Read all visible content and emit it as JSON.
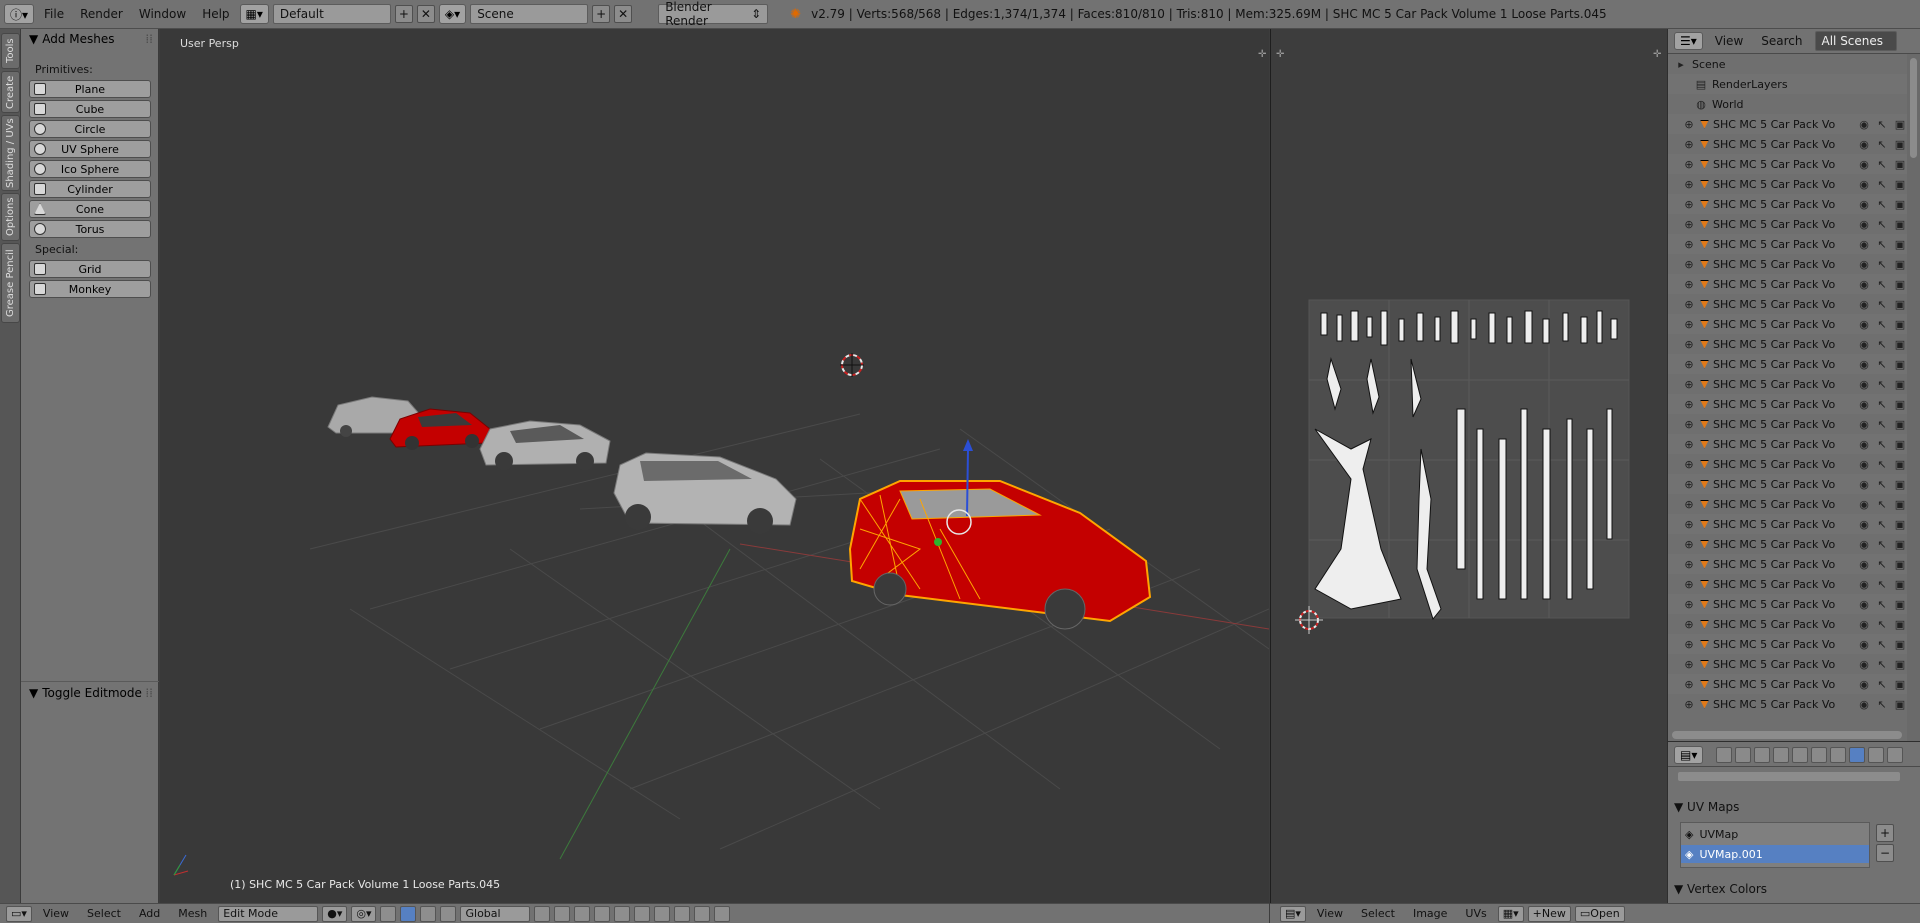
{
  "topbar": {
    "menus": [
      "File",
      "Render",
      "Window",
      "Help"
    ],
    "layout": "Default",
    "scene": "Scene",
    "engine": "Blender Render",
    "info": "v2.79 | Verts:568/568 | Edges:1,374/1,374 | Faces:810/810 | Tris:810 | Mem:325.69M | SHC MC 5 Car Pack Volume 1 Loose Parts.045"
  },
  "tabs": [
    "Tools",
    "Create",
    "Shading / UVs",
    "Options",
    "Grease Pencil"
  ],
  "shelf": {
    "add_meshes": "Add Meshes",
    "primitives_label": "Primitives:",
    "primitives": [
      "Plane",
      "Cube",
      "Circle",
      "UV Sphere",
      "Ico Sphere",
      "Cylinder",
      "Cone",
      "Torus"
    ],
    "special_label": "Special:",
    "special": [
      "Grid",
      "Monkey"
    ],
    "toggle": "Toggle Editmode"
  },
  "viewport": {
    "label": "User Persp",
    "object": "(1) SHC MC 5 Car Pack Volume 1 Loose Parts.045"
  },
  "outliner": {
    "view": "View",
    "search": "Search",
    "scenes": "All Scenes",
    "scene": "Scene",
    "renderlayers": "RenderLayers",
    "world": "World",
    "object_name": "SHC MC 5 Car Pack Vo",
    "object_count": 30
  },
  "props": {
    "uvmaps_label": "UV Maps",
    "uvmaps": [
      "UVMap",
      "UVMap.001"
    ],
    "vertex_colors": "Vertex Colors"
  },
  "bottom_vp": {
    "menus": [
      "View",
      "Select",
      "Add",
      "Mesh"
    ],
    "mode": "Edit Mode",
    "orientation": "Global"
  },
  "bottom_uv": {
    "menus": [
      "View",
      "Select",
      "Image",
      "UVs"
    ],
    "new": "New",
    "open": "Open"
  },
  "colors": {
    "selected_row": "#5680c2",
    "wire": "#ffa500",
    "car_red": "#c40000",
    "car_gray": "#a9a9a9"
  }
}
